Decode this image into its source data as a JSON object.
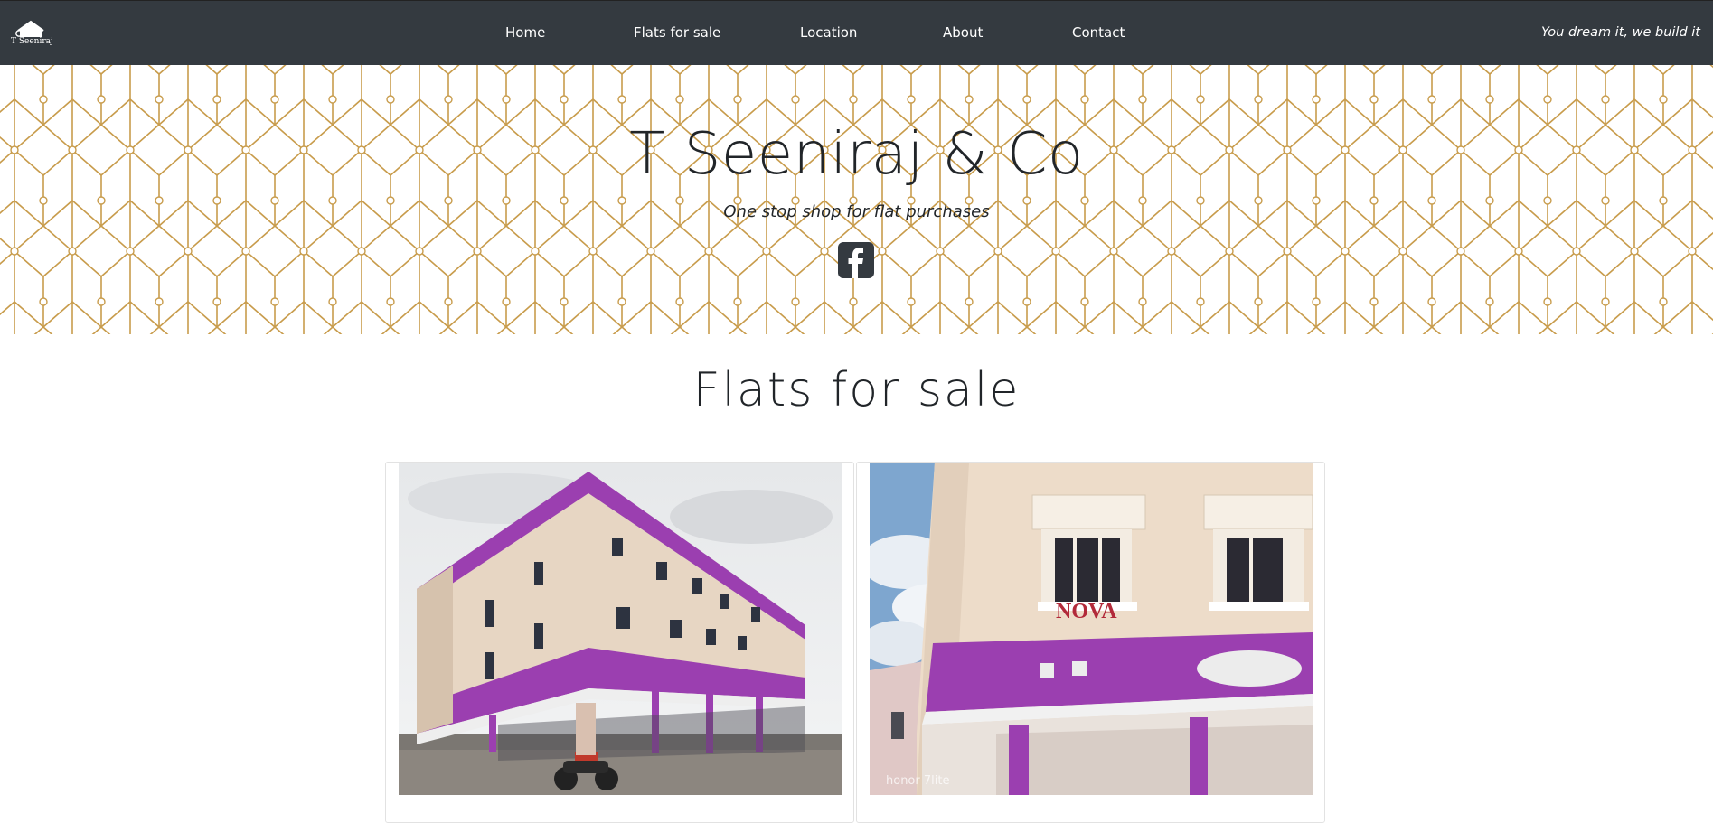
{
  "brand": {
    "logo_text": "T Seeniraj"
  },
  "nav": {
    "items": [
      {
        "label": "Home"
      },
      {
        "label": "Flats for sale"
      },
      {
        "label": "Location"
      },
      {
        "label": "About"
      },
      {
        "label": "Contact"
      }
    ],
    "tagline": "You dream it, we build it"
  },
  "hero": {
    "title": "T Seeniraj & Co",
    "subtitle": "One stop shop for flat purchases",
    "social_icon": "facebook-icon"
  },
  "flats": {
    "title": "Flats for sale",
    "cards": [
      {
        "image": "building-photo-icon"
      },
      {
        "image": "building-nova-photo-icon",
        "sign_text": "NOVA",
        "watermark": "honor 7lite"
      }
    ]
  },
  "colors": {
    "navbar": "#343a40",
    "pattern": "#c89c4c",
    "accent_purple": "#9b3fb0"
  }
}
